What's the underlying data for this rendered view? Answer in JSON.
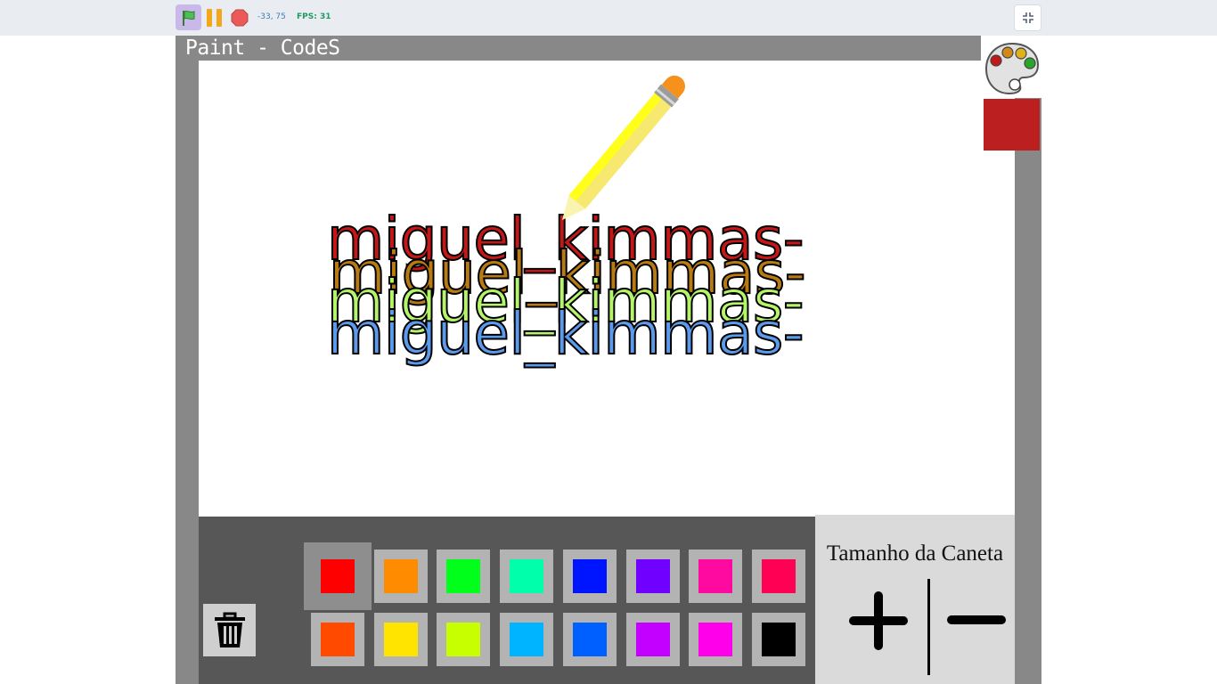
{
  "topbar": {
    "flag_icon": "green-flag-icon",
    "pause_icon": "pause-icon",
    "stop_icon": "stop-icon",
    "coords": "-33,   75",
    "fps": "FPS: 31",
    "fullscreen_icon": "exit-fullscreen-icon"
  },
  "stage": {
    "title": "Paint - CodeS",
    "palette_icon": "palette-icon",
    "current_color": "#bb1f1f"
  },
  "canvas": {
    "drawn_lines": [
      {
        "text": "miguel_kimmas-",
        "color": "#c41818"
      },
      {
        "text": "miguel_kimmas-",
        "color": "#b87a12"
      },
      {
        "text": "miguel_kimmas-",
        "color": "#b5f56a"
      },
      {
        "text": "miguel_kimmas-",
        "color": "#5c9aec"
      }
    ],
    "pencil_icon": "pencil-icon"
  },
  "toolbar": {
    "trash_icon": "trash-icon",
    "colors_row1": [
      "#ff0000",
      "#ff8c00",
      "#00ff1a",
      "#00ffab",
      "#0015ff",
      "#7000ff",
      "#ff0aa0",
      "#ff0055"
    ],
    "colors_row2": [
      "#ff4a00",
      "#ffe400",
      "#c8ff00",
      "#00b4ff",
      "#0060ff",
      "#c300ff",
      "#ff00ea",
      "#000000"
    ],
    "selected_index": 0
  },
  "pen_size": {
    "title": "Tamanho da Caneta",
    "plus_icon": "plus-icon",
    "minus_icon": "minus-icon"
  }
}
